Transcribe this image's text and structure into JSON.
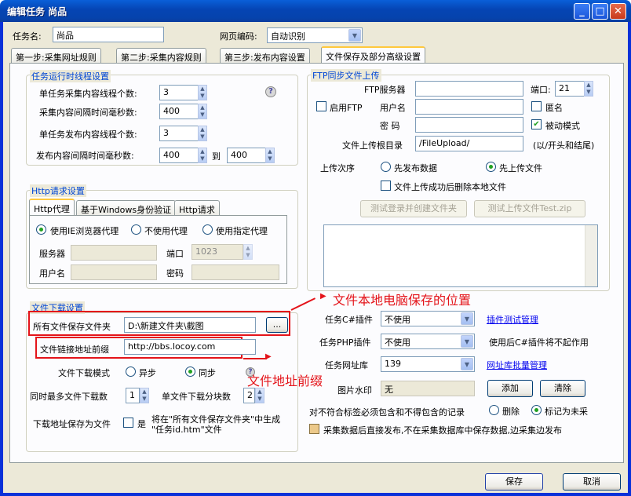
{
  "window": {
    "title": "编辑任务  尚品",
    "minimize": "_",
    "maximize": "□",
    "close": "✕"
  },
  "header": {
    "task_name_label": "任务名:",
    "task_name_value": "尚品",
    "encoding_label": "网页编码:",
    "encoding_value": "自动识别"
  },
  "tabs": [
    "第一步:采集网址规则",
    "第二步:采集内容规则",
    "第三步:发布内容设置",
    "文件保存及部分高级设置"
  ],
  "runtime": {
    "title": "任务运行时线程设置",
    "threads_label": "单任务采集内容线程个数:",
    "threads_value": "3",
    "interval_label": "采集内容间隔时间毫秒数:",
    "interval_value": "400",
    "pub_threads_label": "单任务发布内容线程个数:",
    "pub_threads_value": "3",
    "pub_interval_label": "发布内容间隔时间毫秒数:",
    "pub_interval_from": "400",
    "to_label": "到",
    "pub_interval_to": "400"
  },
  "http": {
    "title": "Http请求设置",
    "tabs": [
      "Http代理",
      "基于Windows身份验证",
      "Http请求"
    ],
    "proxy_ie": "使用IE浏览器代理",
    "proxy_none": "不使用代理",
    "proxy_custom": "使用指定代理",
    "server_label": "服务器",
    "port_label": "端口",
    "port_value": "1023",
    "user_label": "用户名",
    "password_label": "密码"
  },
  "ftp": {
    "title": "FTP同步文件上传",
    "server_label": "FTP服务器",
    "port_label": "端口:",
    "port_value": "21",
    "enable_label": "启用FTP",
    "user_label": "用户名",
    "anonymous_label": "匿名",
    "password_label": "密  码",
    "passive_label": "被动模式",
    "root_label": "文件上传根目录",
    "root_value": "/FileUpload/",
    "root_hint": "(以/开头和结尾)",
    "order_label": "上传次序",
    "order_publish": "先发布数据",
    "order_upload": "先上传文件",
    "delete_label": "文件上传成功后删除本地文件",
    "test_login": "测试登录并创建文件夹",
    "test_upload": "测试上传文件Test.zip"
  },
  "download": {
    "title": "文件下载设置",
    "folder_label": "所有文件保存文件夹",
    "folder_value": "D:\\新建文件夹\\截图",
    "browse": "...",
    "prefix_label": "文件链接地址前缀",
    "prefix_value": "http://bbs.locoy.com",
    "mode_label": "文件下载模式",
    "mode_async": "异步",
    "mode_sync": "同步",
    "max_label": "同时最多文件下载数",
    "max_value": "1",
    "chunks_label": "单文件下载分块数",
    "chunks_value": "2",
    "save_as_label": "下载地址保存为文件",
    "save_as_check": "是",
    "save_as_desc": "将在\"所有文件保存文件夹\"中生成 \"任务id.htm\"文件"
  },
  "plugins": {
    "csharp_label": "任务C#插件",
    "csharp_value": "不使用",
    "csharp_link": "插件测试管理",
    "php_label": "任务PHP插件",
    "php_value": "不使用",
    "php_note": "使用后C#插件将不起作用",
    "url_label": "任务网址库",
    "url_value": "139",
    "url_link": "网址库批量管理",
    "watermark_label": "图片水印",
    "watermark_value": "无",
    "add": "添加",
    "clear": "清除",
    "nomatch_label": "对不符合标签必须包含和不得包含的记录",
    "nomatch_delete": "删除",
    "nomatch_mark": "标记为未采",
    "direct_publish": "采集数据后直接发布,不在采集数据库中保存数据,边采集边发布"
  },
  "annotations": {
    "location": "文件本地电脑保存的位置",
    "prefix": "文件地址前缀"
  },
  "footer": {
    "save": "保存",
    "cancel": "取消"
  },
  "colors": {
    "title_blue": "#0544b3",
    "group_title": "#0046d5",
    "annotation_red": "#e4141a",
    "check_green": "#21a121"
  }
}
